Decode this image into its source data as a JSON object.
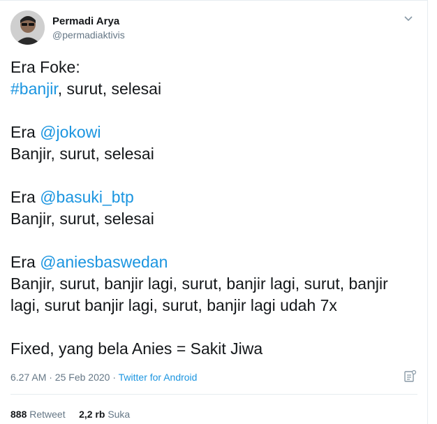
{
  "author": {
    "name": "Permadi Arya",
    "handle": "@permadiaktivis",
    "avatar_icon": "user-avatar"
  },
  "tweet": {
    "lines": {
      "l1": "Era Foke:",
      "l2_tag": "#banjir",
      "l2_rest": ", surut, selesai",
      "l3_pre": "Era ",
      "l3_mention": "@jokowi",
      "l4": "Banjir, surut, selesai",
      "l5_pre": "Era ",
      "l5_mention": "@basuki_btp",
      "l6": "Banjir, surut, selesai",
      "l7_pre": "Era ",
      "l7_mention": "@aniesbaswedan",
      "l8": "Banjir, surut, banjir lagi, surut, banjir lagi, surut, banjir",
      "l9": "lagi, surut banjir lagi, surut, banjir lagi udah 7x",
      "l10": "Fixed, yang bela Anies = Sakit Jiwa"
    }
  },
  "meta": {
    "timestamp": "6.27 AM · 25 Feb 2020 · ",
    "source": "Twitter for Android"
  },
  "stats": {
    "retweets_count": "888",
    "retweets_label": "Retweet",
    "likes_count": "2,2 rb",
    "likes_label": "Suka"
  },
  "colors": {
    "link": "#1b95e0",
    "secondary": "#657786"
  }
}
